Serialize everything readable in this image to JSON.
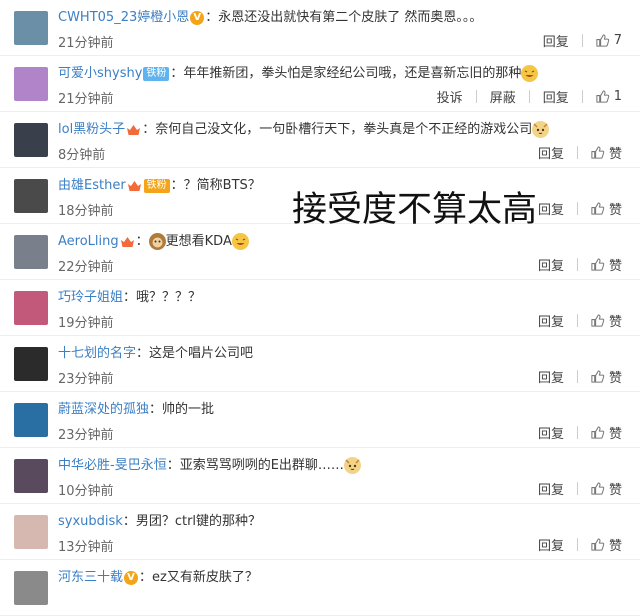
{
  "comments": [
    {
      "user": "CWHT05_23婷橙小恩",
      "badge": "vip",
      "text": "：永恩还没出就快有第二个皮肤了 然而奥恩。。。",
      "time": "21分钟前",
      "actions": [
        "回复"
      ],
      "like": "7",
      "avatar_color": "#6c8fa8",
      "emoji": ""
    },
    {
      "user": "可爱小shyshy",
      "badge": "铁粉",
      "text": "：年年推新团，拳头怕是家经纪公司哦，还是喜新忘旧的那种",
      "time": "21分钟前",
      "actions": [
        "投诉",
        "屏蔽",
        "回复"
      ],
      "like": "1",
      "avatar_color": "#b184c9",
      "emoji": "laugh"
    },
    {
      "user": "lol黑粉头子",
      "badge": "crown",
      "text": "：奈何自己没文化，一句卧槽行天下，拳头真是个不正经的游戏公司",
      "time": "8分钟前",
      "actions": [
        "回复"
      ],
      "like": "赞",
      "avatar_color": "#3a3f4c",
      "emoji": "cat"
    },
    {
      "user": "由雄Esther",
      "badge": "crown-fan",
      "fan_label": "铁粉",
      "text": "：？简称BTS？",
      "time": "18分钟前",
      "actions": [
        "回复"
      ],
      "like": "赞",
      "avatar_color": "#4a4a4a",
      "emoji": ""
    },
    {
      "user": "AeroLling",
      "badge": "crown",
      "text": "：",
      "text_after": "更想看KDA",
      "time": "22分钟前",
      "actions": [
        "回复"
      ],
      "like": "赞",
      "avatar_color": "#7a7f8c",
      "emoji": "laugh",
      "emoji_before": "monkey"
    },
    {
      "user": "巧玲子姐姐",
      "badge": "",
      "text": "：哦？？？？",
      "time": "19分钟前",
      "actions": [
        "回复"
      ],
      "like": "赞",
      "avatar_color": "#c2587a",
      "emoji": ""
    },
    {
      "user": "十七划的名字",
      "badge": "",
      "text": "：这是个唱片公司吧",
      "time": "23分钟前",
      "actions": [
        "回复"
      ],
      "like": "赞",
      "avatar_color": "#2b2b2b",
      "emoji": ""
    },
    {
      "user": "蔚蓝深处的孤独",
      "badge": "",
      "text": "：帅的一批",
      "time": "23分钟前",
      "actions": [
        "回复"
      ],
      "like": "赞",
      "avatar_color": "#2a6fa3",
      "emoji": ""
    },
    {
      "user": "中华必胜-旻巴永恒",
      "badge": "",
      "text": "：亚索骂骂咧咧的E出群聊……",
      "time": "10分钟前",
      "actions": [
        "回复"
      ],
      "like": "赞",
      "avatar_color": "#5a4a5e",
      "emoji": "cat"
    },
    {
      "user": "syxubdisk",
      "badge": "",
      "text": "：男团？ctrl键的那种？",
      "time": "13分钟前",
      "actions": [
        "回复"
      ],
      "like": "赞",
      "avatar_color": "#d7b8b0",
      "emoji": ""
    },
    {
      "user": "河东三十载",
      "badge": "vip",
      "text": "：ez又有新皮肤了？",
      "time": "",
      "actions": [],
      "like": "",
      "avatar_color": "#8a8a8a",
      "emoji": ""
    }
  ],
  "overlay_text": "接受度不算太高"
}
